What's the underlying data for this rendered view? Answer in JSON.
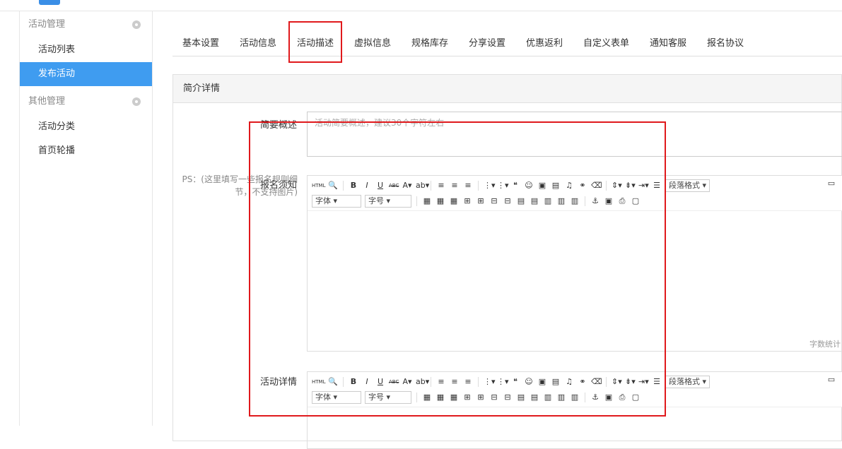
{
  "sidebar": {
    "groups": [
      {
        "label": "活动管理",
        "items": [
          "活动列表",
          "发布活动"
        ]
      },
      {
        "label": "其他管理",
        "items": [
          "活动分类",
          "首页轮播"
        ]
      }
    ]
  },
  "tabs": [
    "基本设置",
    "活动信息",
    "活动描述",
    "虚拟信息",
    "规格库存",
    "分享设置",
    "优惠返利",
    "自定义表单",
    "通知客服",
    "报名协议"
  ],
  "panel": {
    "title": "简介详情",
    "summary_label": "简要概述",
    "summary_placeholder": "活动简要概述，建议30个字符左右",
    "notice_label": "报名须知",
    "notice_ps": "PS：(这里填写一些报名规则细节，不支持图片)",
    "detail_label": "活动详情",
    "editor": {
      "html_btn": "HTML",
      "bold": "B",
      "italic": "I",
      "underline": "U",
      "strike": "ABC",
      "paragraph_select": "段落格式",
      "font_select": "字体",
      "size_select": "字号",
      "word_count": "字数统计"
    }
  }
}
